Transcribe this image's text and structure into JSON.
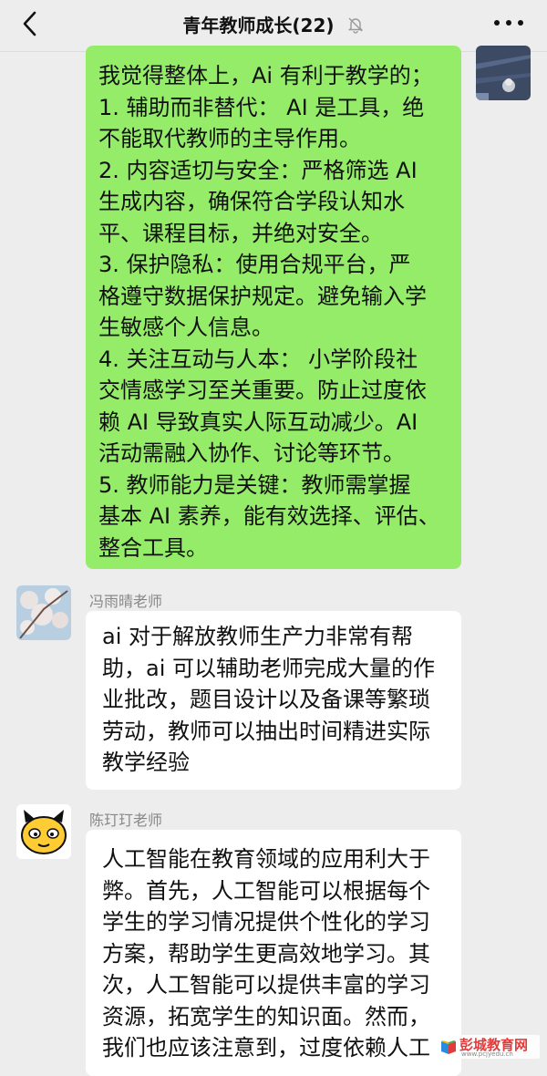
{
  "header": {
    "title": "青年教师成长(22)"
  },
  "messages": [
    {
      "side": "right",
      "text": "我觉得整体上，Ai 有利于教学的；\n1. 辅助而非替代： AI 是工具，绝\n不能取代教师的主导作用。\n2. 内容适切与安全：严格筛选 AI\n生成内容，确保符合学段认知水\n平、课程目标，并绝对安全。\n3. 保护隐私：使用合规平台，严\n格遵守数据保护规定。避免输入学\n生敏感个人信息。\n4. 关注互动与人本： 小学阶段社\n交情感学习至关重要。防止过度依\n赖 AI 导致真实人际互动减少。AI\n活动需融入协作、讨论等环节。\n5. 教师能力是关键：教师需掌握\n基本 AI 素养，能有效选择、评估、\n整合工具。"
    },
    {
      "side": "left",
      "sender": "冯雨晴老师",
      "text": "ai 对于解放教师生产力非常有帮\n助，ai 可以辅助老师完成大量的作\n业批改，题目设计以及备课等繁琐\n劳动，教师可以抽出时间精进实际\n教学经验"
    },
    {
      "side": "left",
      "sender": "陈玎玎老师",
      "text": "人工智能在教育领域的应用利大于\n弊。首先，人工智能可以根据每个\n学生的学习情况提供个性化的学习\n方案，帮助学生更高效地学习。其\n次，人工智能可以提供丰富的学习\n资源，拓宽学生的知识面。然而，\n我们也应该注意到，过度依赖人工"
    }
  ],
  "watermark": {
    "text": "彭城教育网",
    "url": "www.pcjyedu.cn"
  },
  "colors": {
    "background": "#ededed",
    "self_bubble": "#95ec69",
    "other_bubble": "#ffffff",
    "watermark_red": "#e23b3b"
  },
  "icons": [
    "back-arrow-icon",
    "mute-bell-icon",
    "more-icon",
    "avatar-image"
  ]
}
